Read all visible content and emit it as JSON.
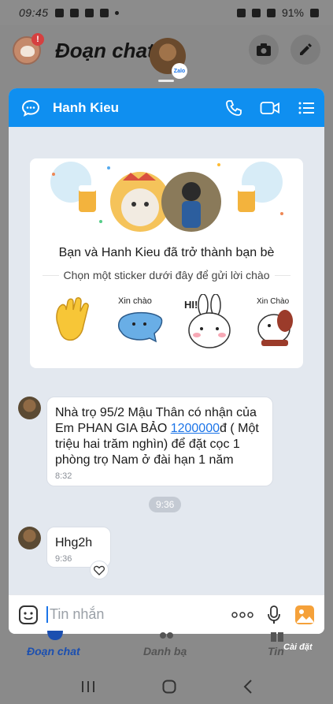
{
  "status_bar": {
    "time": "09:45",
    "battery": "91%"
  },
  "background_app": {
    "title": "Đoạn chat",
    "notification_count": "!",
    "zalo_tag": "Zalo",
    "tabs": [
      "Đoạn chat",
      "Danh bạ",
      "Tin"
    ],
    "settings_label": "Cài đặt"
  },
  "chat": {
    "contact_name": "Hanh Kieu",
    "welcome": {
      "title": "Bạn và Hanh Kieu đã trở thành bạn bè",
      "subtitle": "Chọn một sticker dưới đây để gửi lời chào",
      "stickers": [
        "waving-hand",
        "Xin chào",
        "HI!",
        "Xin Chào"
      ]
    },
    "messages": [
      {
        "text_before": "Nhà trọ 95/2 Mậu Thân có nhận của Em PHAN GIA BẢO ",
        "phone": "1200000",
        "text_after": "đ ( Một triệu hai trăm nghìn) để đặt cọc 1 phòng trọ Nam ở đài hạn 1 năm",
        "time": "8:32"
      },
      {
        "text": "Hhg2h",
        "time": "9:36"
      }
    ],
    "separator_time": "9:36",
    "composer_placeholder": "Tin nhắn"
  },
  "colors": {
    "accent": "#0f8ff0",
    "link": "#1b74e8"
  }
}
